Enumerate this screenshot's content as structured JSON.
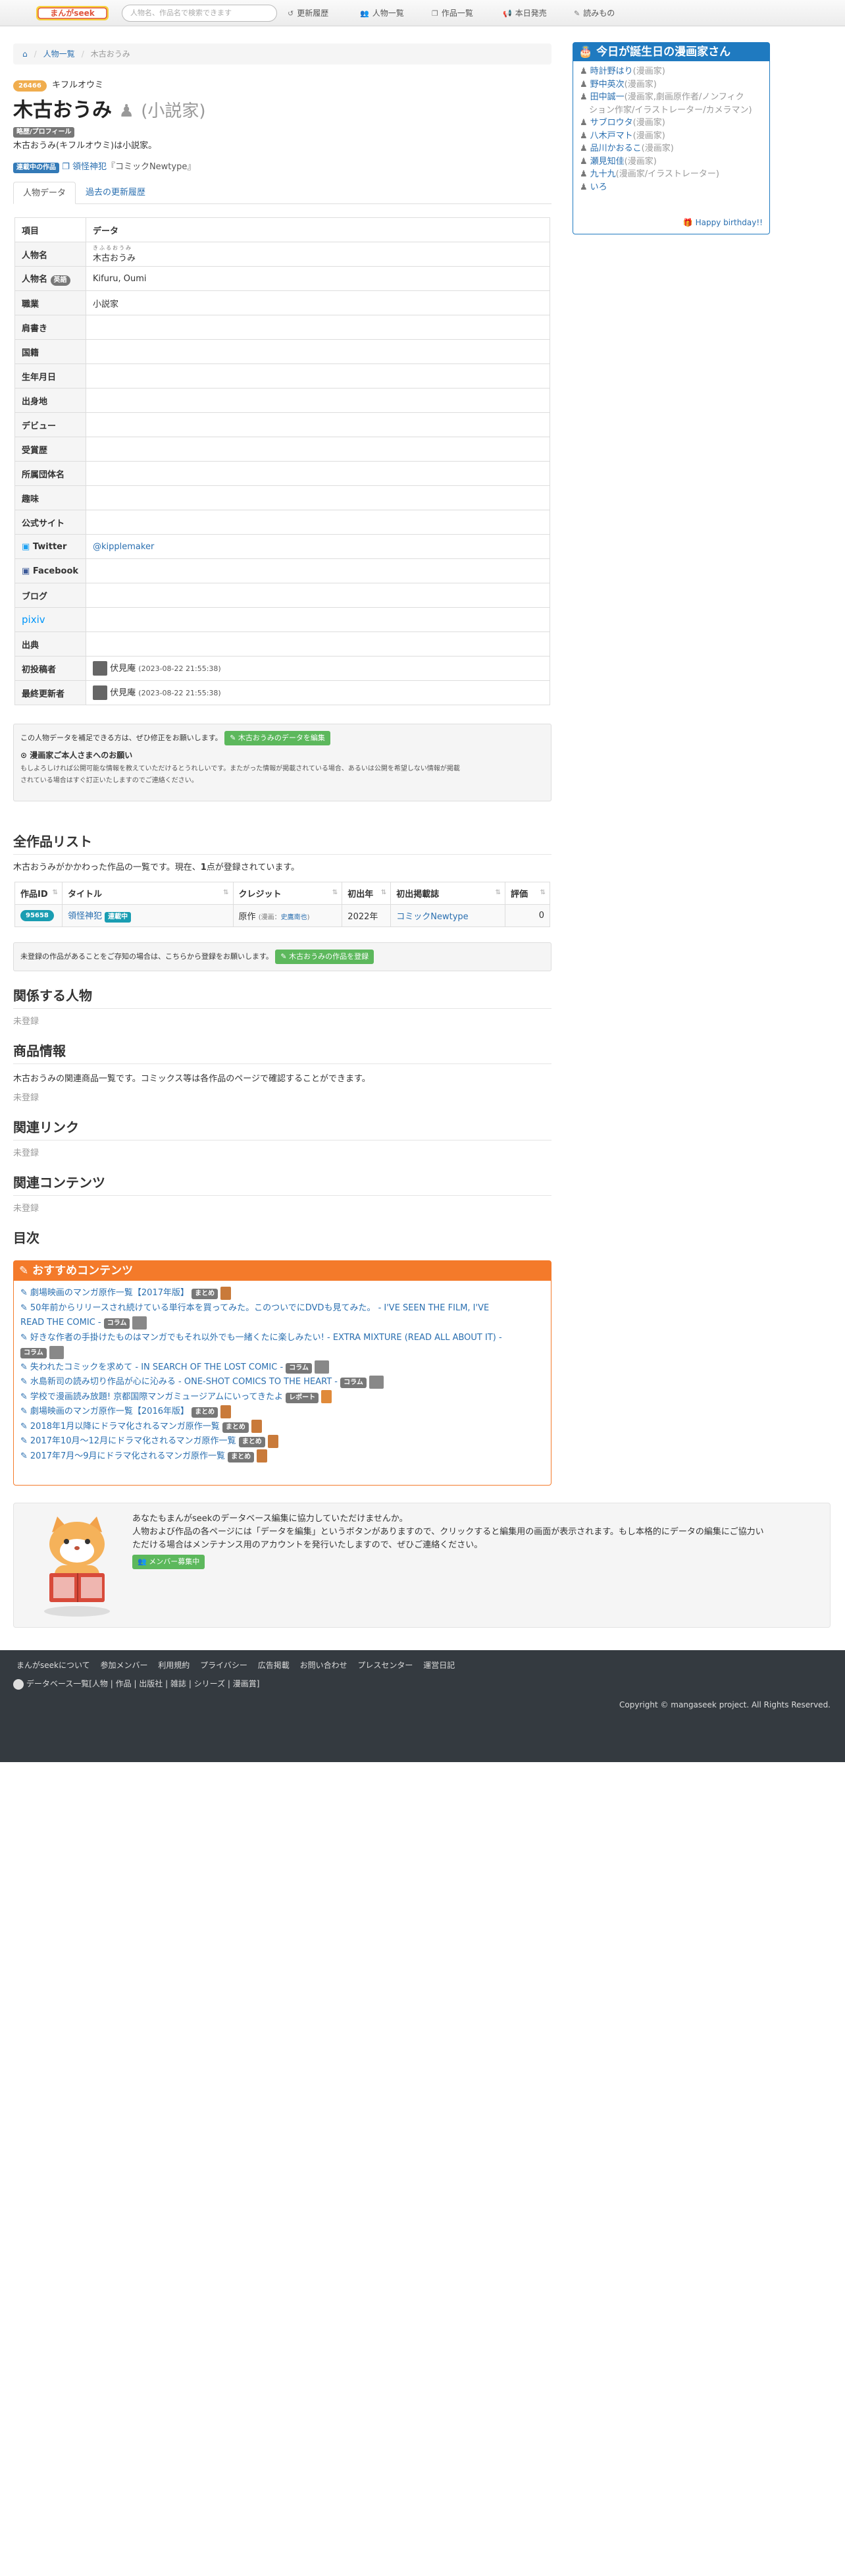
{
  "header": {
    "logo_text": "まんがseek",
    "search_placeholder": "人物名、作品名で検索できます",
    "nav": [
      {
        "icon": "history-icon",
        "glyph": "↺",
        "label": "更新履歴"
      },
      {
        "icon": "people-icon",
        "glyph": "👥",
        "label": "人物一覧"
      },
      {
        "icon": "book-icon",
        "glyph": "❐",
        "label": "作品一覧"
      },
      {
        "icon": "megaphone-icon",
        "glyph": "📢",
        "label": "本日発売"
      },
      {
        "icon": "edit-icon",
        "glyph": "✎",
        "label": "読みもの"
      }
    ]
  },
  "breadcrumb": {
    "home_glyph": "⌂",
    "list": "人物一覧",
    "current": "木古おうみ"
  },
  "person": {
    "id": "26466",
    "kana": "キフルオウミ",
    "name": "木古おうみ",
    "role": "(小説家)",
    "profile_label": "略歴/プロフィール",
    "profile_text": "木古おうみ(キフルオウミ)は小説家。",
    "serial_label": "連載中の作品",
    "serial_work": "領怪神犯",
    "serial_magazine": "『コミックNewtype』"
  },
  "tabs": [
    "人物データ",
    "過去の更新履歴"
  ],
  "info": {
    "head_key": "項目",
    "head_val": "データ",
    "ruby": "きふるおうみ",
    "rows": [
      {
        "k": "人物名",
        "v": "木古おうみ"
      },
      {
        "k": "人物名",
        "badge": "英語",
        "v": "Kifuru, Oumi"
      },
      {
        "k": "職業",
        "v": "小説家"
      },
      {
        "k": "肩書き",
        "v": ""
      },
      {
        "k": "国籍",
        "v": ""
      },
      {
        "k": "生年月日",
        "v": ""
      },
      {
        "k": "出身地",
        "v": ""
      },
      {
        "k": "デビュー",
        "v": ""
      },
      {
        "k": "受賞歴",
        "v": ""
      },
      {
        "k": "所属団体名",
        "v": ""
      },
      {
        "k": "趣味",
        "v": ""
      },
      {
        "k": "公式サイト",
        "v": ""
      },
      {
        "k": "Twitter",
        "v": "@kipplemaker"
      },
      {
        "k": "Facebook",
        "v": ""
      },
      {
        "k": "ブログ",
        "v": ""
      },
      {
        "k": "pixiv",
        "v": ""
      },
      {
        "k": "出典",
        "v": ""
      },
      {
        "k": "初投稿者",
        "v": "伏見庵",
        "date": "(2023-08-22 21:55:38)"
      },
      {
        "k": "最終更新者",
        "v": "伏見庵",
        "date": "(2023-08-22 21:55:38)"
      }
    ]
  },
  "editbox": {
    "text": "この人物データを補足できる方は、ぜひ修正をお願いします。",
    "button": "木古おうみのデータを編集",
    "notice_title": "漫画家ご本人さまへのお願い",
    "notice_text1": "もしよろしければ公開可能な情報を教えていただけるとうれしいです。またがった情報が掲載されている場合、あるいは公開を希望しない情報が掲載",
    "notice_text2": "されている場合はすぐ訂正いたしますのでご連絡ください。"
  },
  "works": {
    "title": "全作品リスト",
    "desc_prefix": "木古おうみがかかわった作品の一覧です。現在、",
    "count": "1",
    "desc_suffix": "点が登録されています。",
    "headers": [
      "作品ID",
      "タイトル",
      "クレジット",
      "初出年",
      "初出掲載誌",
      "評価"
    ],
    "rows": [
      {
        "id": "95658",
        "title": "領怪神犯",
        "badge": "連載中",
        "credit": "原作",
        "credit_note": "(漫画：",
        "credit_person": "史鷹南也",
        "credit_close": ")",
        "year": "2022年",
        "magazine": "コミックNewtype",
        "score": "0"
      }
    ],
    "register_text": "未登録の作品があることをご存知の場合は、こちらから登録をお願いします。",
    "register_button": "木古おうみの作品を登録"
  },
  "sections": {
    "related_people": "関係する人物",
    "related_people_none": "未登録",
    "products": "商品情報",
    "products_desc": "木古おうみの関連商品一覧です。コミックス等は各作品のページで確認することができます。",
    "products_none": "未登録",
    "links": "関連リンク",
    "links_none": "未登録",
    "contents": "関連コンテンツ",
    "contents_none": "未登録",
    "toc": "目次"
  },
  "reco": {
    "title": "おすすめコンテンツ",
    "items": [
      {
        "text": "劇場映画のマンガ原作一覧【2017年版】",
        "tag": "まとめ"
      },
      {
        "text": "50年前からリリースされ続けている単行本を買ってみた。このついでにDVDも見てみた。 - I'VE SEEN THE FILM, I'VE",
        "text2": "READ THE COMIC -",
        "tag": "コラム"
      },
      {
        "text": "好きな作者の手掛けたものはマンガでもそれ以外でも一緒くたに楽しみたい! - EXTRA MIXTURE (READ ALL ABOUT IT) -",
        "text2": "",
        "tag": "コラム"
      },
      {
        "text": "失われたコミックを求めて - IN SEARCH OF THE LOST COMIC -",
        "tag": "コラム"
      },
      {
        "text": "水島新司の読み切り作品が心に沁みる - ONE-SHOT COMICS TO THE HEART -",
        "tag": "コラム"
      },
      {
        "text": "学校で漫画読み放題! 京都国際マンガミュージアムにいってきたよ",
        "tag": "レポート"
      },
      {
        "text": "劇場映画のマンガ原作一覧【2016年版】",
        "tag": "まとめ"
      },
      {
        "text": "2018年1月以降にドラマ化されるマンガ原作一覧",
        "tag": "まとめ"
      },
      {
        "text": "2017年10月〜12月にドラマ化されるマンガ原作一覧",
        "tag": "まとめ"
      },
      {
        "text": "2017年7月〜9月にドラマ化されるマンガ原作一覧",
        "tag": "まとめ"
      }
    ]
  },
  "help": {
    "line1": "あなたもまんがseekのデータベース編集に協力していただけませんか。",
    "line2": "人物および作品の各ページには「データを編集」というボタンがありますので、クリックすると編集用の画面が表示されます。もし本格的にデータの編集にご協力い",
    "line3": "ただける場合はメンテナンス用のアカウントを発行いたしますので、ぜひご連絡ください。",
    "button": "メンバー募集中"
  },
  "footer": {
    "links": [
      "まんがseekについて",
      "参加メンバー",
      "利用規約",
      "プライバシー",
      "広告掲載",
      "お問い合わせ",
      "プレスセンター",
      "運営日記"
    ],
    "db_label": "データベース一覧",
    "db_links": [
      "人物",
      "作品",
      "出版社",
      "雑誌",
      "シリーズ",
      "漫画賞"
    ],
    "copyright": "Copyright © mangaseek project. All Rights Reserved."
  },
  "birthday": {
    "title": "今日が誕生日の漫画家さん",
    "items": [
      {
        "name": "時計野はり",
        "role": "(漫画家)"
      },
      {
        "name": "野中英次",
        "role": "(漫画家)"
      },
      {
        "name": "田中誠一",
        "role": "(漫画家,劇画原作者/ノンフィク"
      },
      {
        "name": "",
        "role": "ション作家/イラストレーター/カメラマン)"
      },
      {
        "name": "サブロウタ",
        "role": "(漫画家)"
      },
      {
        "name": "八木戸マト",
        "role": "(漫画家)"
      },
      {
        "name": "品川かおるこ",
        "role": "(漫画家)"
      },
      {
        "name": "瀬見知佳",
        "role": "(漫画家)"
      },
      {
        "name": "九十九",
        "role": "(漫画家/イラストレーター)"
      },
      {
        "name": "いろ",
        "role": ""
      }
    ],
    "footer": "Happy birthday!!"
  },
  "colors": {
    "accent": "#1f7ac0",
    "orange": "#f47a2a",
    "green": "#5cb85c",
    "badge": "#f0ad4e"
  }
}
